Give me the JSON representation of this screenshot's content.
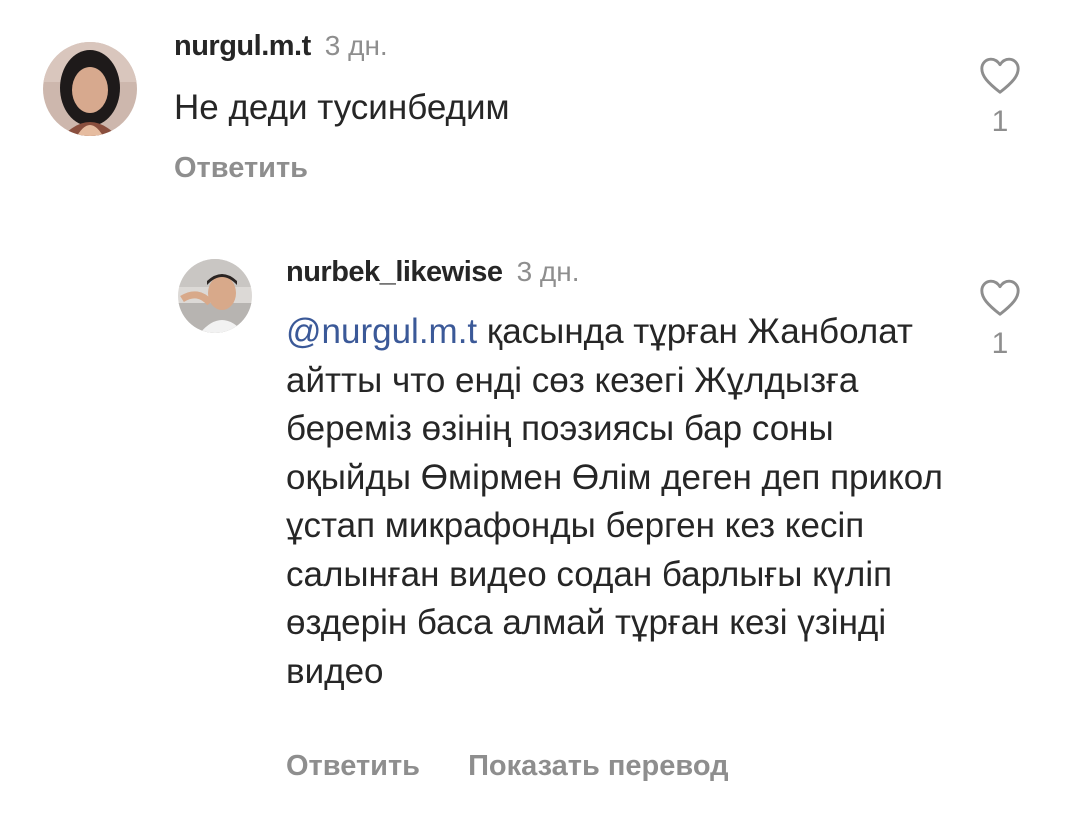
{
  "comments": [
    {
      "username": "nurgul.m.t",
      "time": "3 дн.",
      "text": "Не деди тусинбедим",
      "reply_label": "Ответить",
      "like_count": "1",
      "like_icon": "heart-outline-icon"
    },
    {
      "username": "nurbek_likewise",
      "time": "3 дн.",
      "mention": "@nurgul.m.t",
      "text": " қасында тұрған Жанболат айтты что енді сөз кезегі Жұлдызға береміз өзінің поэзиясы бар соны оқыйды Өмірмен Өлім деген деп прикол ұстап микрафонды берген кез кесіп салынған видео содан барлығы күліп өздерін баса алмай тұрған кезі үзінді видео",
      "reply_label": "Ответить",
      "translate_label": "Показать перевод",
      "like_count": "1",
      "like_icon": "heart-outline-icon"
    }
  ],
  "colors": {
    "text": "#262626",
    "secondary": "#8e8e8e",
    "mention": "#3b5998",
    "background": "#ffffff"
  }
}
